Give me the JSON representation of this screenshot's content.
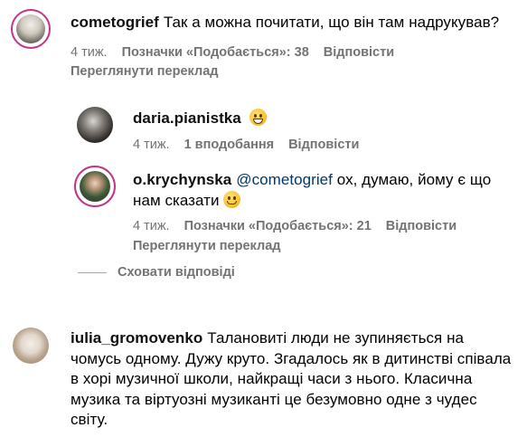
{
  "comments": [
    {
      "username": "cometogrief",
      "text": "Так а можна почитати, що він там надрукував?",
      "time": "4 тиж.",
      "likes": "Позначки «Подобається»: 38",
      "reply": "Відповісти",
      "translate": "Переглянути переклад",
      "avatar_icon": "avatar-photo"
    },
    {
      "username": "daria.pianistka",
      "text": "",
      "emoji": "grinning-face",
      "time": "4 тиж.",
      "likes": "1 вподобання",
      "reply": "Відповісти",
      "avatar_icon": "avatar-photo"
    },
    {
      "username": "o.krychynska",
      "mention": "@cometogrief",
      "text": "ох, думаю, йому є що нам сказати",
      "emoji": "grinning-face",
      "time": "4 тиж.",
      "likes": "Позначки «Подобається»: 21",
      "reply": "Відповісти",
      "translate": "Переглянути переклад",
      "avatar_icon": "avatar-photo"
    },
    {
      "username": "iulia_gromovenko",
      "text": "Талановиті люди не зупиняється на чомусь одному. Дужу круто. Згадалось як в дитинстві співала в хорі музичної школи, найкращі часи з нього. Класична музика та віртуозні музиканті це безумовно одне з чудес світу.",
      "avatar_icon": "avatar-photo"
    }
  ],
  "hide_replies": "Сховати відповіді",
  "colors": {
    "muted": "#737373",
    "mention": "#00376b",
    "story_ring": "#c13584"
  }
}
